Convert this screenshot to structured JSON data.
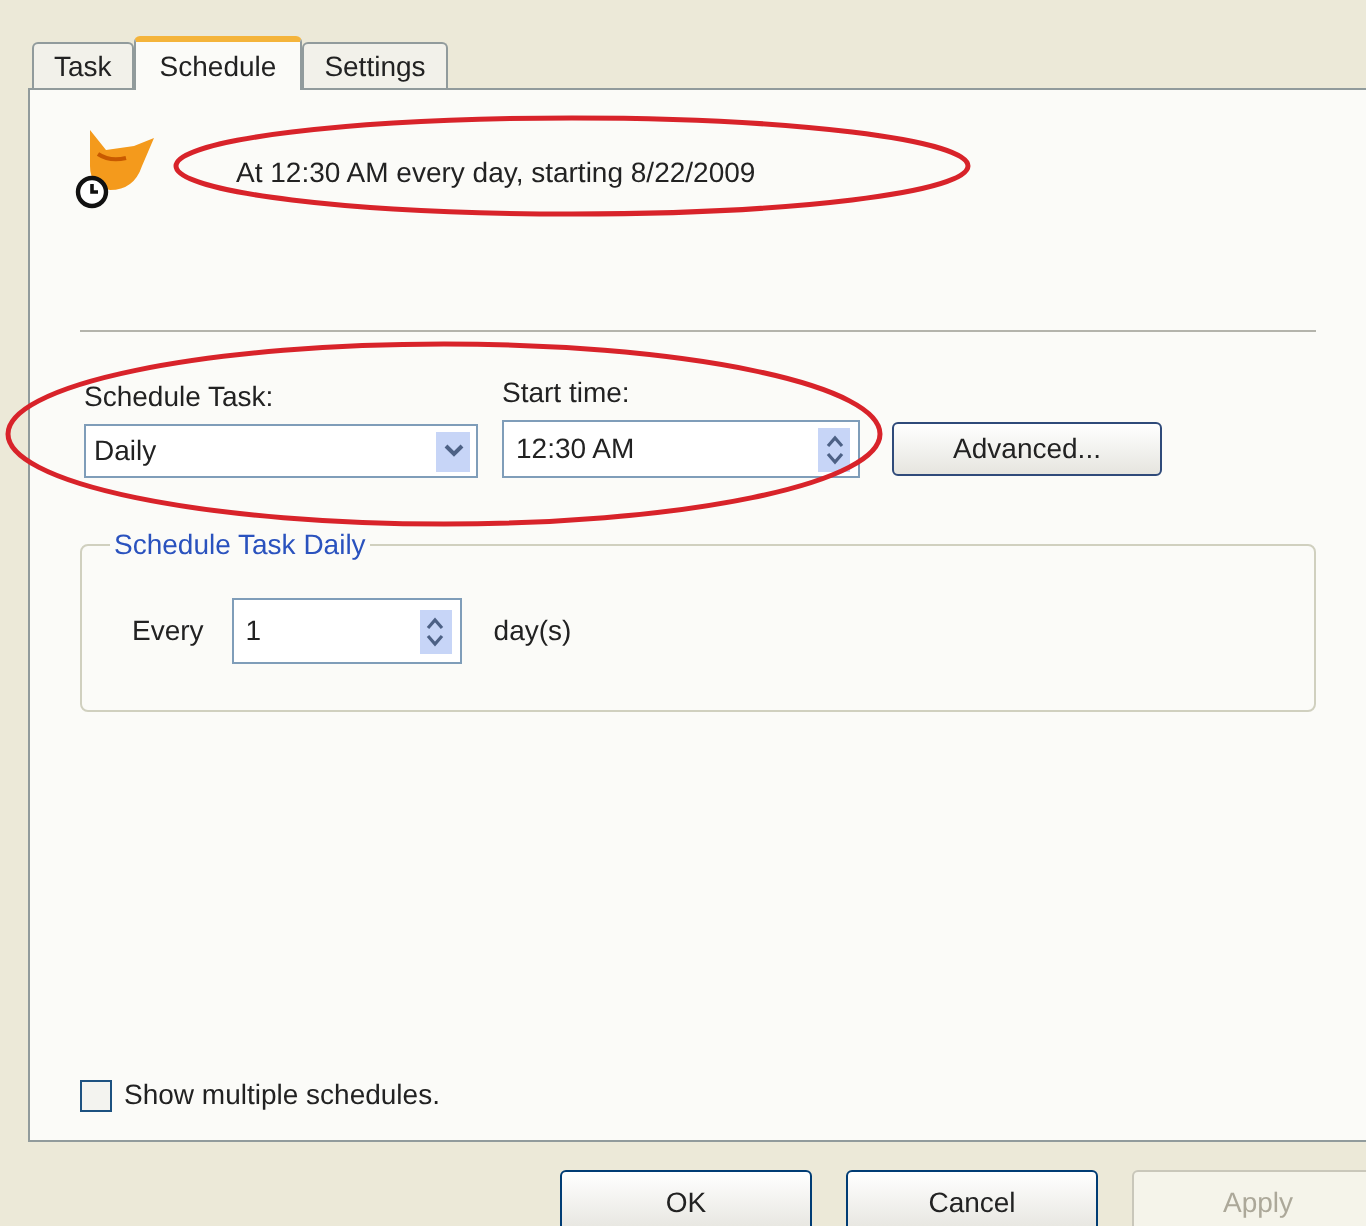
{
  "tabs": [
    {
      "label": "Task",
      "selected": false
    },
    {
      "label": "Schedule",
      "selected": true
    },
    {
      "label": "Settings",
      "selected": false
    }
  ],
  "summary": "At 12:30 AM every day, starting 8/22/2009",
  "schedule_task": {
    "label": "Schedule Task:",
    "value": "Daily"
  },
  "start_time": {
    "label": "Start time:",
    "value": "12:30 AM"
  },
  "advanced_button": "Advanced...",
  "group": {
    "title": "Schedule Task Daily",
    "every_label": "Every",
    "value": "1",
    "unit": "day(s)"
  },
  "multiple_schedules": {
    "label": "Show multiple schedules.",
    "checked": false
  },
  "buttons": [
    {
      "label": "OK",
      "disabled": false
    },
    {
      "label": "Cancel",
      "disabled": false
    },
    {
      "label": "Apply",
      "disabled": true
    }
  ]
}
